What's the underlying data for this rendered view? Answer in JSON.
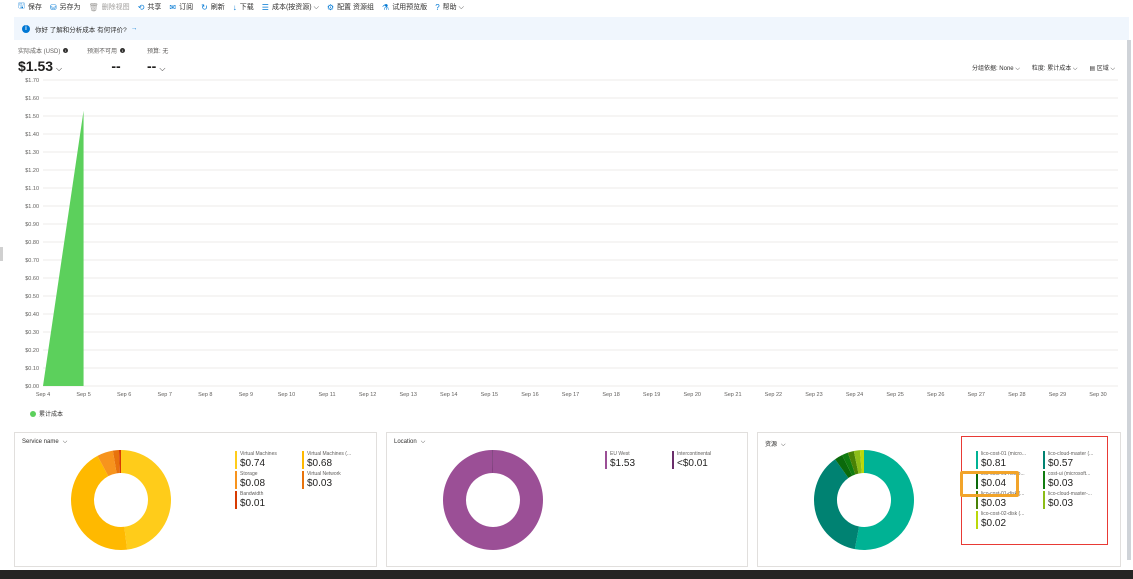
{
  "toolbar": {
    "items": [
      {
        "icon": "save-icon",
        "glyph": "🖫",
        "label": "保存"
      },
      {
        "icon": "save-as-icon",
        "glyph": "⛁",
        "label": "另存为"
      },
      {
        "icon": "delete-icon",
        "glyph": "🗑",
        "label": "删除视图",
        "disabled": true
      },
      {
        "icon": "share-icon",
        "glyph": "⟲",
        "label": "共享"
      },
      {
        "icon": "mail-icon",
        "glyph": "✉",
        "label": "订阅"
      },
      {
        "icon": "refresh-icon",
        "glyph": "↻",
        "label": "刷新"
      },
      {
        "icon": "download-icon",
        "glyph": "↓",
        "label": "下载"
      },
      {
        "icon": "list-icon",
        "glyph": "☰",
        "label": "成本(按资源) ⌵"
      },
      {
        "icon": "gear-icon",
        "glyph": "⚙",
        "label": "配置 资源组"
      },
      {
        "icon": "flask-icon",
        "glyph": "⚗",
        "label": "试用预览版"
      },
      {
        "icon": "help-icon",
        "glyph": "?",
        "label": "帮助 ⌵"
      }
    ]
  },
  "banner": {
    "text": "你好 了解和分析成本 有何评价?",
    "arrow": "→"
  },
  "kpis": [
    {
      "label": "实际成本 (USD)",
      "value": "$1.53",
      "has_info": true,
      "has_chevron": true
    },
    {
      "label": "预测不可用",
      "value": "--",
      "has_info": true,
      "has_chevron": false
    },
    {
      "label": "预算: 无",
      "value": "-- ",
      "has_info": false,
      "has_chevron": true
    }
  ],
  "controls": {
    "granularity": "分组依据: None ⌵",
    "view": "粒度: 累计成本 ⌵",
    "chart": "▤ 区域 ⌵"
  },
  "chart_data": {
    "type": "area",
    "y_tick_labels": [
      "$1.70",
      "$1.60",
      "$1.50",
      "$1.40",
      "$1.30",
      "$1.20",
      "$1.10",
      "$1.00",
      "$0.90",
      "$0.80",
      "$0.70",
      "$0.60",
      "$0.50",
      "$0.40",
      "$0.30",
      "$0.20",
      "$0.10",
      "$0.00"
    ],
    "ylim": [
      0,
      1.6
    ],
    "x": [
      "Sep 4",
      "Sep 5",
      "Sep 6",
      "Sep 7",
      "Sep 8",
      "Sep 9",
      "Sep 10",
      "Sep 11",
      "Sep 12",
      "Sep 13",
      "Sep 14",
      "Sep 15",
      "Sep 16",
      "Sep 17",
      "Sep 18",
      "Sep 19",
      "Sep 20",
      "Sep 21",
      "Sep 22",
      "Sep 23",
      "Sep 24",
      "Sep 25",
      "Sep 26",
      "Sep 27",
      "Sep 28",
      "Sep 29",
      "Sep 30"
    ],
    "series": [
      {
        "name": "累计成本",
        "color": "#5cd05c",
        "values": [
          0,
          1.53
        ]
      }
    ]
  },
  "panels": [
    {
      "title": "Service name",
      "slices": [
        {
          "label": "Virtual Machines",
          "value": "$0.74",
          "amount": 0.74,
          "color": "#ffcc1a"
        },
        {
          "label": "Virtual Machines (...",
          "value": "$0.68",
          "amount": 0.68,
          "color": "#ffb900"
        },
        {
          "label": "Storage",
          "value": "$0.08",
          "amount": 0.08,
          "color": "#f7941d"
        },
        {
          "label": "Virtual Network",
          "value": "$0.03",
          "amount": 0.03,
          "color": "#e8730c"
        },
        {
          "label": "Bandwidth",
          "value": "$0.01",
          "amount": 0.01,
          "color": "#d83b01"
        }
      ]
    },
    {
      "title": "Location",
      "slices": [
        {
          "label": "EU West",
          "value": "$1.53",
          "amount": 1.53,
          "color": "#9b4f96"
        },
        {
          "label": "Intercontinental",
          "value": "<$0.01",
          "amount": 0.004,
          "color": "#6b2e6b"
        }
      ]
    },
    {
      "title": "资源",
      "slices": [
        {
          "label": "lico-cost-01 (micro...",
          "value": "$0.81",
          "amount": 0.81,
          "color": "#00b294"
        },
        {
          "label": "lico-cloud-master (...",
          "value": "$0.57",
          "amount": 0.57,
          "color": "#008272"
        },
        {
          "label": "lico-cost-01-micro...",
          "value": "$0.04",
          "amount": 0.04,
          "color": "#0b6a0b"
        },
        {
          "label": "cost-ui (microsoft...",
          "value": "$0.03",
          "amount": 0.03,
          "color": "#107c10"
        },
        {
          "label": "lico-cost-01-disk (...",
          "value": "$0.03",
          "amount": 0.03,
          "color": "#498205"
        },
        {
          "label": "lico-cloud-master-...",
          "value": "$0.03",
          "amount": 0.03,
          "color": "#8cbd18"
        },
        {
          "label": "lico-cost-02-disk (...",
          "value": "$0.02",
          "amount": 0.02,
          "color": "#bad80a"
        }
      ]
    }
  ]
}
